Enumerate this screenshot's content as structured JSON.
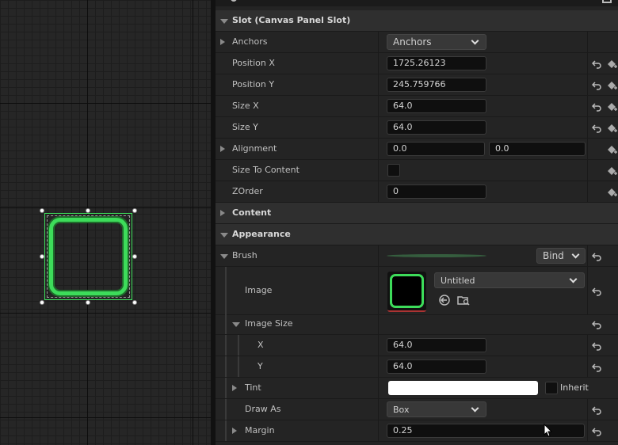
{
  "viewport": {
    "widget_color": "#3ddc5a"
  },
  "details": {
    "slot_section": "Slot (Canvas Panel Slot)",
    "anchors": {
      "label": "Anchors",
      "value": "Anchors"
    },
    "position_x": {
      "label": "Position X",
      "value": "1725.26123"
    },
    "position_y": {
      "label": "Position Y",
      "value": "245.759766"
    },
    "size_x": {
      "label": "Size X",
      "value": "64.0"
    },
    "size_y": {
      "label": "Size Y",
      "value": "64.0"
    },
    "alignment": {
      "label": "Alignment",
      "x": "0.0",
      "y": "0.0"
    },
    "size_to_content": {
      "label": "Size To Content",
      "checked": false
    },
    "zorder": {
      "label": "ZOrder",
      "value": "0"
    },
    "content_section": "Content",
    "appearance_section": "Appearance",
    "brush": {
      "label": "Brush",
      "bind_label": "Bind"
    },
    "image": {
      "label": "Image",
      "asset": "Untitled"
    },
    "image_size": {
      "label": "Image Size",
      "x_label": "X",
      "x": "64.0",
      "y_label": "Y",
      "y": "64.0"
    },
    "tint": {
      "label": "Tint",
      "color": "#ffffff",
      "inherit_label": "Inherit"
    },
    "draw_as": {
      "label": "Draw As",
      "value": "Box"
    },
    "margin": {
      "label": "Margin",
      "value": "0.25"
    }
  }
}
